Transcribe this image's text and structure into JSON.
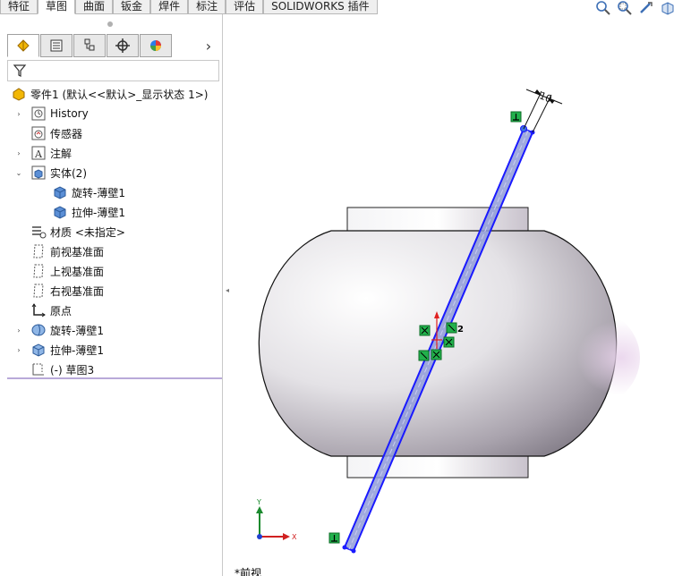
{
  "command_tabs": [
    "特征",
    "草图",
    "曲面",
    "钣金",
    "焊件",
    "标注",
    "评估",
    "SOLIDWORKS 插件"
  ],
  "active_tab": "草图",
  "view_toolbar_icons": [
    "zoom-to-fit-icon",
    "zoom-area-icon",
    "previous-view-icon",
    "section-view-icon"
  ],
  "property_manager_tabs": [
    "featuremanager-tab-icon",
    "propertymanager-tab-icon",
    "configurationmanager-tab-icon",
    "dimxpert-tab-icon",
    "display-manager-tab-icon"
  ],
  "more_tabs_glyph": "›",
  "tree": {
    "root": "零件1  (默认<<默认>_显示状态 1>)",
    "items": [
      {
        "label": "History",
        "icon": "history-icon",
        "expander": "›"
      },
      {
        "label": "传感器",
        "icon": "sensor-icon",
        "expander": ""
      },
      {
        "label": "注解",
        "icon": "annotation-icon",
        "expander": "›"
      },
      {
        "label": "实体(2)",
        "icon": "solid-bodies-icon",
        "expander": "⌄"
      },
      {
        "label": "旋转-薄壁1",
        "icon": "body-icon",
        "expander": ""
      },
      {
        "label": "拉伸-薄壁1",
        "icon": "body-icon",
        "expander": ""
      },
      {
        "label": "材质 <未指定>",
        "icon": "material-icon",
        "expander": ""
      },
      {
        "label": "前视基准面",
        "icon": "plane-icon",
        "expander": ""
      },
      {
        "label": "上视基准面",
        "icon": "plane-icon",
        "expander": ""
      },
      {
        "label": "右视基准面",
        "icon": "plane-icon",
        "expander": ""
      },
      {
        "label": "原点",
        "icon": "origin-icon",
        "expander": ""
      },
      {
        "label": "旋转-薄壁1",
        "icon": "revolve-icon",
        "expander": "›"
      },
      {
        "label": "拉伸-薄壁1",
        "icon": "extrude-icon",
        "expander": "›"
      },
      {
        "label": "(-) 草图3",
        "icon": "sketch-icon",
        "expander": ""
      }
    ]
  },
  "graphics": {
    "dimension_value": "10",
    "relation_count": "2",
    "triad_y": "Y",
    "triad_x": "X",
    "view_label": "*前视"
  },
  "colors": {
    "sketch_blue": "#1a1aff",
    "relation_green": "#22b14c",
    "tree_separator": "#b9a9d9",
    "body_face": "#e8e6ea"
  }
}
